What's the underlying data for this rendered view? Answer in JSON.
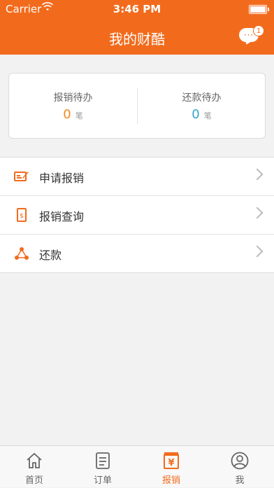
{
  "status_bar": {
    "carrier": "Carrier",
    "time": "3:46 PM"
  },
  "header": {
    "title": "我的财酷",
    "message_badge": "1",
    "message_bubble": "···"
  },
  "summary": {
    "left": {
      "label": "报销待办",
      "value": "0",
      "unit": "笔"
    },
    "right": {
      "label": "还款待办",
      "value": "0",
      "unit": "笔"
    }
  },
  "menu": [
    {
      "label": "申请报销",
      "icon": "edit-form-icon"
    },
    {
      "label": "报销查询",
      "icon": "receipt-search-icon"
    },
    {
      "label": "还款",
      "icon": "share-nodes-icon"
    }
  ],
  "tabs": [
    {
      "label": "首页",
      "icon": "home-icon"
    },
    {
      "label": "订单",
      "icon": "order-doc-icon"
    },
    {
      "label": "报销",
      "icon": "yen-receipt-icon"
    },
    {
      "label": "我",
      "icon": "user-icon"
    }
  ],
  "active_tab": "报销",
  "colors": {
    "accent": "#f26b1d",
    "value_orange": "#f2891e",
    "value_blue": "#33a7c9"
  }
}
